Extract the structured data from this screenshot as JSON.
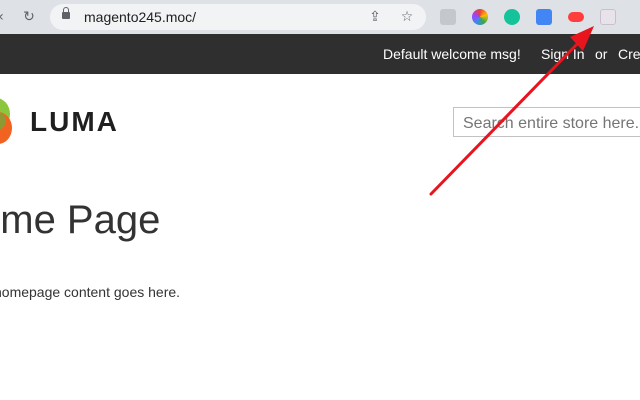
{
  "browser": {
    "url": "magento245.moc/",
    "icons": [
      "back-icon",
      "reload-icon",
      "lock-icon",
      "share-icon",
      "bookmark-star-icon"
    ],
    "extensions": [
      {
        "name": "mail-extension-icon",
        "color": "#9aa0a6"
      },
      {
        "name": "color-wheel-extension-icon",
        "color": "#ea4335"
      },
      {
        "name": "grammarly-extension-icon",
        "color": "#15c39a"
      },
      {
        "name": "translate-extension-icon",
        "color": "#4285f4"
      },
      {
        "name": "video-extension-icon",
        "color": "#ff3d3d"
      },
      {
        "name": "profile-extension-icon",
        "color": "#e8e3ea"
      }
    ]
  },
  "header": {
    "welcome": "Default welcome msg!",
    "sign_in": "Sign In",
    "or": "or",
    "create": "Cre"
  },
  "logo": {
    "text": "LUMA"
  },
  "search": {
    "placeholder": "Search entire store here..."
  },
  "page": {
    "title": "ome Page",
    "content": "homepage content goes here."
  },
  "colors": {
    "header_bg": "#2f2f2f",
    "arrow": "#e8141e",
    "logo_orange": "#f26322",
    "logo_green": "#8cc63f"
  }
}
